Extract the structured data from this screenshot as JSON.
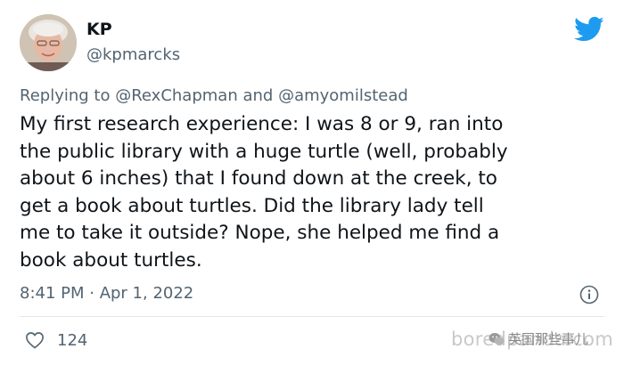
{
  "author": {
    "name": "KP",
    "handle": "@kpmarcks"
  },
  "reply": {
    "prefix": "Replying to",
    "mention1": "@RexChapman",
    "conjunction": "and",
    "mention2": "@amyomilstead"
  },
  "tweet": {
    "lines": [
      "My first research experience: I was 8 or 9, ran into",
      "the public library with a huge turtle (well, probably",
      "about 6 inches) that I found down at the creek, to",
      "get a book about turtles. Did the library lady tell",
      "me to take it outside? Nope, she helped me find a",
      "book about turtles."
    ]
  },
  "meta": {
    "timestamp": "8:41 PM · Apr 1, 2022"
  },
  "stats": {
    "likes": "124"
  },
  "watermark": {
    "site": "boredpanda.com",
    "account": "英国那些事儿"
  },
  "colors": {
    "twitter_blue": "#1d9bf0",
    "secondary_text": "#536471",
    "primary_text": "#0f1419"
  },
  "icons": {
    "brand": "twitter-bird-icon",
    "info": "info-icon",
    "like": "heart-icon"
  }
}
